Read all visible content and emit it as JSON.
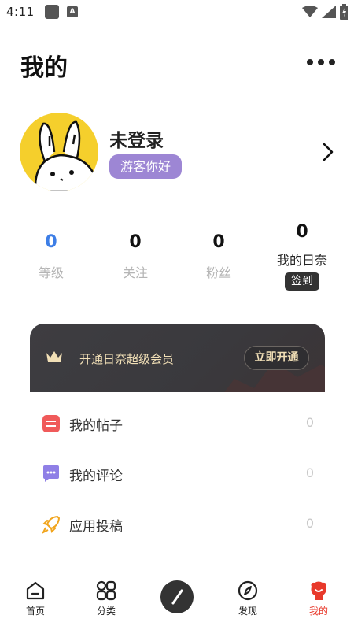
{
  "status_bar": {
    "time": "4:11",
    "app_badge": "A"
  },
  "header": {
    "title": "我的"
  },
  "profile": {
    "username": "未登录",
    "badge": "游客你好"
  },
  "stats": [
    {
      "value": "0",
      "label": "等级"
    },
    {
      "value": "0",
      "label": "关注"
    },
    {
      "value": "0",
      "label": "粉丝"
    },
    {
      "value": "0",
      "label": "我的日奈",
      "action": "签到"
    }
  ],
  "vip": {
    "text": "开通日奈超级会员",
    "button": "立即开通"
  },
  "menu": [
    {
      "label": "我的帖子",
      "count": "0",
      "icon": "post-icon"
    },
    {
      "label": "我的评论",
      "count": "0",
      "icon": "comment-icon"
    },
    {
      "label": "应用投稿",
      "count": "0",
      "icon": "rocket-icon"
    }
  ],
  "nav": [
    {
      "label": "首页",
      "icon": "home-icon"
    },
    {
      "label": "分类",
      "icon": "category-icon"
    },
    {
      "label": "",
      "icon": "compose-icon"
    },
    {
      "label": "发现",
      "icon": "compass-icon"
    },
    {
      "label": "我的",
      "icon": "profile-icon",
      "active": true
    }
  ],
  "colors": {
    "accent_blue": "#3d7ee6",
    "badge_purple": "#9d86d4",
    "avatar_yellow": "#f5cf2c",
    "nav_active": "#e8392b",
    "vip_gold": "#f1dfb6"
  }
}
